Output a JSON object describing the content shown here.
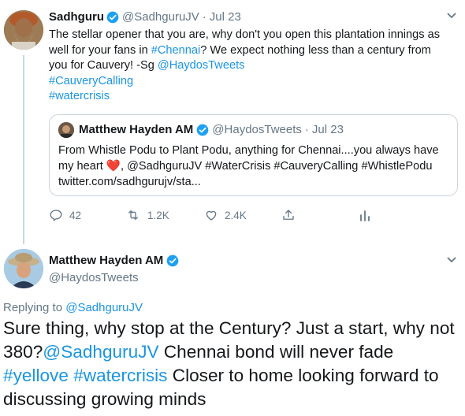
{
  "tweet1": {
    "name": "Sadhguru",
    "handle": "@SadhguruJV",
    "dot": "·",
    "date": "Jul 23",
    "body_line1": "The stellar opener that you are, why don't you open this plantation innings as",
    "body_line2_pre": "well for your fans in ",
    "body_line2_link": "#Chennai",
    "body_line2_post": "? We expect nothing less than a century from",
    "body_line3": "you for Cauvery! -Sg ",
    "body_line3_link": "@HaydosTweets",
    "hashtag1": "#CauveryCalling",
    "hashtag2": "#watercrisis",
    "quote": {
      "name": "Matthew Hayden AM",
      "handle": "@HaydosTweets",
      "dot": "·",
      "date": "Jul 23",
      "line1": "From Whistle Podu to Plant Podu, anything for Chennai....you always have",
      "line2_pre": "my heart ",
      "heart": "❤️",
      "line2_post": ", @SadhguruJV #WaterCrisis #CauveryCalling #WhistlePodu",
      "line3": "twitter.com/sadhgurujv/sta..."
    },
    "actions": {
      "replies": "42",
      "retweets": "1.2K",
      "likes": "2.4K"
    }
  },
  "tweet2": {
    "name": "Matthew Hayden AM",
    "handle": "@HaydosTweets",
    "replying_label": "Replying to ",
    "replying_handle": "@SadhguruJV",
    "line1": "Sure thing, why stop at the Century? Just a start, why not",
    "line2_pre": "380?",
    "line2_link": "@SadhguruJV",
    "line2_post": " Chennai bond will never fade",
    "line3_tag1": "#yellove",
    "line3_space": " ",
    "line3_tag2": "#watercrisis",
    "line3_post": " Closer to home looking forward to",
    "line4": "discussing growing minds"
  },
  "colors": {
    "link": "#1b95e0",
    "muted": "#657786",
    "text": "#14171a",
    "border": "#ccd6dd",
    "verified": "#1da1f2",
    "heart": "#e0245e"
  },
  "icons": [
    "verified-badge-icon",
    "chevron-down-icon",
    "reply-icon",
    "retweet-icon",
    "like-icon",
    "share-icon",
    "analytics-icon"
  ]
}
